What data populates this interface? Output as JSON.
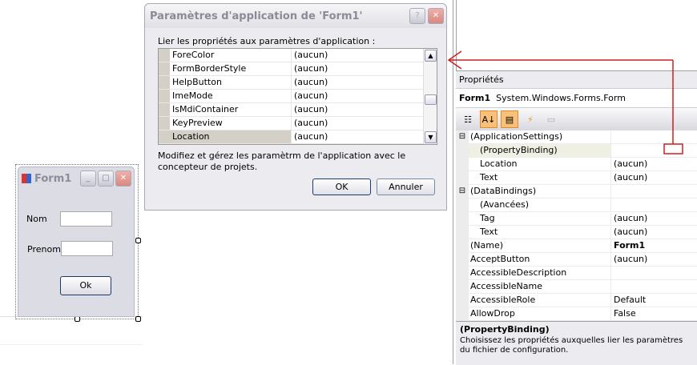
{
  "form1": {
    "title": "Form1",
    "nom_label": "Nom",
    "prenom_label": "Prenom",
    "ok_label": "Ok",
    "nom_value": "",
    "prenom_value": ""
  },
  "dialog": {
    "title": "Paramètres d'application de 'Form1'",
    "help": "?",
    "close": "✕",
    "prompt": "Lier les propriétés aux paramètres d'application :",
    "rows": [
      {
        "name": "ForeColor",
        "value": "(aucun)"
      },
      {
        "name": "FormBorderStyle",
        "value": "(aucun)"
      },
      {
        "name": "HelpButton",
        "value": "(aucun)"
      },
      {
        "name": "ImeMode",
        "value": "(aucun)"
      },
      {
        "name": "IsMdiContainer",
        "value": "(aucun)"
      },
      {
        "name": "KeyPreview",
        "value": "(aucun)"
      },
      {
        "name": "Location",
        "value": "(aucun)"
      }
    ],
    "note": "Modifiez et gérez les paramètrm de l'application avec le concepteur de projets.",
    "ok": "OK",
    "cancel": "Annuler"
  },
  "properties": {
    "header": "Propriétés",
    "object_name": "Form1",
    "object_type": "System.Windows.Forms.Form",
    "rows": [
      {
        "toggle": "⊟",
        "name": "(ApplicationSettings)",
        "value": "",
        "indent": 0
      },
      {
        "toggle": "",
        "name": "(PropertyBinding)",
        "value": "",
        "indent": 1
      },
      {
        "toggle": "",
        "name": "Location",
        "value": "(aucun)",
        "indent": 1
      },
      {
        "toggle": "",
        "name": "Text",
        "value": "(aucun)",
        "indent": 1
      },
      {
        "toggle": "⊟",
        "name": "(DataBindings)",
        "value": "",
        "indent": 0
      },
      {
        "toggle": "",
        "name": "(Avancées)",
        "value": "",
        "indent": 1
      },
      {
        "toggle": "",
        "name": "Tag",
        "value": "(aucun)",
        "indent": 1
      },
      {
        "toggle": "",
        "name": "Text",
        "value": "(aucun)",
        "indent": 1
      },
      {
        "toggle": "",
        "name": "(Name)",
        "value": "Form1",
        "indent": 0
      },
      {
        "toggle": "",
        "name": "AcceptButton",
        "value": "(aucun)",
        "indent": 0
      },
      {
        "toggle": "",
        "name": "AccessibleDescription",
        "value": "",
        "indent": 0
      },
      {
        "toggle": "",
        "name": "AccessibleName",
        "value": "",
        "indent": 0
      },
      {
        "toggle": "",
        "name": "AccessibleRole",
        "value": "Default",
        "indent": 0
      },
      {
        "toggle": "",
        "name": "AllowDrop",
        "value": "False",
        "indent": 0
      }
    ],
    "desc_title": "(PropertyBinding)",
    "desc_text": "Choisissez les propriétés auxquelles lier les paramètres du fichier de configuration."
  },
  "annotation_color": "#cc2020"
}
